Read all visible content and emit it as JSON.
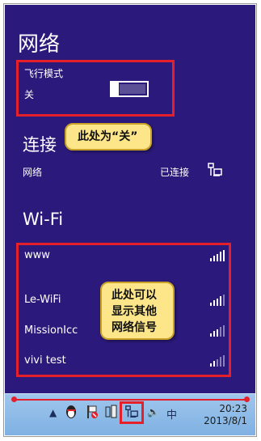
{
  "panel": {
    "title": "网络",
    "airplane": {
      "label": "飞行模式",
      "state": "关"
    },
    "connections": {
      "heading": "连接",
      "item": {
        "name": "网络",
        "status": "已连接"
      }
    },
    "wifi": {
      "heading": "Wi-Fi",
      "networks": [
        "www",
        "Le-WiFi",
        "MissionIcc",
        "vivi test"
      ]
    }
  },
  "callouts": {
    "off": "此处为“关”",
    "others": "此处可以显示其他网络信号"
  },
  "taskbar": {
    "ime": "中",
    "time": "20:23",
    "date": "2013/8/1"
  },
  "colors": {
    "panel": "#2b1a7b",
    "annotation": "#e5202a",
    "callout_fill": "#fde68a"
  }
}
